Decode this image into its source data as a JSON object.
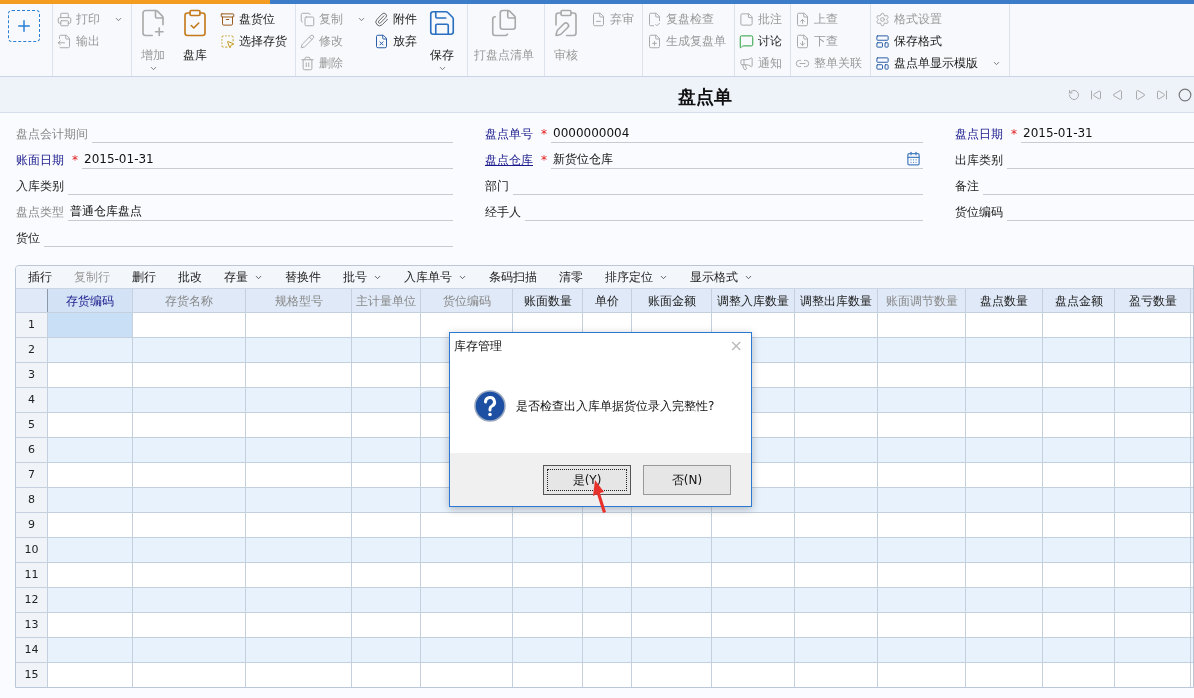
{
  "toolbar": [
    [
      {
        "kind": "new"
      }
    ],
    [
      {
        "kind": "stack",
        "items": [
          {
            "label": "打印",
            "disabled": true,
            "dropdown": true
          },
          {
            "label": "输出",
            "disabled": true,
            "dropdown": false
          }
        ]
      }
    ],
    [
      {
        "kind": "big",
        "label": "增加",
        "disabled": true,
        "dropdown": true
      },
      {
        "kind": "big",
        "label": "盘库",
        "disabled": false,
        "dropdown": false
      },
      {
        "kind": "stack",
        "items": [
          {
            "label": "盘货位",
            "disabled": false,
            "dropdown": false
          },
          {
            "label": "选择存货",
            "disabled": false,
            "dropdown": false
          }
        ]
      }
    ],
    [
      {
        "kind": "stack",
        "items": [
          {
            "label": "复制",
            "disabled": true,
            "dropdown": true
          },
          {
            "label": "修改",
            "disabled": true,
            "dropdown": false
          },
          {
            "label": "删除",
            "disabled": true,
            "dropdown": false
          }
        ]
      },
      {
        "kind": "stack",
        "items": [
          {
            "label": "附件",
            "disabled": false,
            "dropdown": false
          },
          {
            "label": "放弃",
            "disabled": false,
            "dropdown": false
          }
        ]
      },
      {
        "kind": "big",
        "label": "保存",
        "disabled": false,
        "dropdown": true
      }
    ],
    [
      {
        "kind": "big",
        "label": "打盘点清单",
        "disabled": true,
        "dropdown": false
      }
    ],
    [
      {
        "kind": "big",
        "label": "审核",
        "disabled": true,
        "dropdown": false
      },
      {
        "kind": "stack",
        "items": [
          {
            "label": "弃审",
            "disabled": true,
            "dropdown": false
          }
        ]
      }
    ],
    [
      {
        "kind": "stack",
        "items": [
          {
            "label": "复盘检查",
            "disabled": true,
            "dropdown": false
          },
          {
            "label": "生成复盘单",
            "disabled": true,
            "dropdown": false
          }
        ]
      }
    ],
    [
      {
        "kind": "stack",
        "items": [
          {
            "label": "批注",
            "disabled": true,
            "dropdown": false
          },
          {
            "label": "讨论",
            "disabled": false,
            "dropdown": false
          },
          {
            "label": "通知",
            "disabled": true,
            "dropdown": false
          }
        ]
      }
    ],
    [
      {
        "kind": "stack",
        "items": [
          {
            "label": "上查",
            "disabled": true,
            "dropdown": false
          },
          {
            "label": "下查",
            "disabled": true,
            "dropdown": false
          },
          {
            "label": "整单关联",
            "disabled": true,
            "dropdown": false
          }
        ]
      }
    ],
    [
      {
        "kind": "stack",
        "items": [
          {
            "label": "格式设置",
            "disabled": true,
            "dropdown": false
          },
          {
            "label": "保存格式",
            "disabled": false,
            "dropdown": false
          },
          {
            "label": "盘点单显示模版",
            "disabled": false,
            "dropdown": true
          }
        ]
      }
    ]
  ],
  "title": "盘点单",
  "form": [
    [
      {
        "label": "盘点会计期间",
        "disabled": true,
        "link": false,
        "picker": false
      },
      {
        "label": "账面日期",
        "required_mark": "*",
        "value": "2015-01-31",
        "disabled": false,
        "link": false,
        "picker": false
      },
      {
        "label": "入库类别",
        "disabled": false,
        "link": false,
        "picker": false
      },
      {
        "label": "盘点类型",
        "value": "普通仓库盘点",
        "disabled": true,
        "link": false,
        "picker": false
      },
      {
        "label": "货位",
        "disabled": false,
        "link": false,
        "picker": false
      }
    ],
    [
      {
        "label": "盘点单号",
        "required_mark": "*",
        "value": "0000000004",
        "disabled": false,
        "link": false,
        "picker": false
      },
      {
        "label": "盘点仓库",
        "required_mark": "*",
        "value": "新货位仓库",
        "disabled": false,
        "link": true,
        "picker": true
      },
      {
        "label": "部门",
        "disabled": false,
        "link": false,
        "picker": false
      },
      {
        "label": "经手人",
        "disabled": false,
        "link": false,
        "picker": false
      }
    ],
    [
      {
        "label": "盘点日期",
        "required_mark": "*",
        "value": "2015-01-31",
        "disabled": false,
        "link": false,
        "picker": false
      },
      {
        "label": "出库类别",
        "disabled": false,
        "link": false,
        "picker": false
      },
      {
        "label": "备注",
        "disabled": false,
        "link": false,
        "picker": false
      },
      {
        "label": "货位编码",
        "disabled": false,
        "link": false,
        "picker": false
      }
    ]
  ],
  "grid_toolbar": [
    {
      "label": "插行",
      "disabled": false,
      "dropdown": false
    },
    {
      "label": "复制行",
      "disabled": true,
      "dropdown": false
    },
    {
      "label": "删行",
      "disabled": false,
      "dropdown": false
    },
    {
      "label": "批改",
      "disabled": false,
      "dropdown": false
    },
    {
      "label": "存量",
      "disabled": false,
      "dropdown": true
    },
    {
      "label": "替换件",
      "disabled": false,
      "dropdown": false
    },
    {
      "label": "批号",
      "disabled": false,
      "dropdown": true
    },
    {
      "label": "入库单号",
      "disabled": false,
      "dropdown": true
    },
    {
      "label": "条码扫描",
      "disabled": false,
      "dropdown": false
    },
    {
      "label": "清零",
      "disabled": false,
      "dropdown": false
    },
    {
      "label": "排序定位",
      "disabled": false,
      "dropdown": true
    },
    {
      "label": "显示格式",
      "disabled": false,
      "dropdown": true
    }
  ],
  "table": {
    "columns": [
      {
        "label": "存货编码",
        "selected": true,
        "disabled": false
      },
      {
        "label": "存货名称",
        "selected": false,
        "disabled": true
      },
      {
        "label": "规格型号",
        "selected": false,
        "disabled": true
      },
      {
        "label": "主计量单位",
        "selected": false,
        "disabled": true
      },
      {
        "label": "货位编码",
        "selected": false,
        "disabled": true
      },
      {
        "label": "账面数量",
        "selected": false,
        "disabled": false
      },
      {
        "label": "单价",
        "selected": false,
        "disabled": false
      },
      {
        "label": "账面金额",
        "selected": false,
        "disabled": false
      },
      {
        "label": "调整入库数量",
        "selected": false,
        "disabled": false
      },
      {
        "label": "调整出库数量",
        "selected": false,
        "disabled": false
      },
      {
        "label": "账面调节数量",
        "selected": false,
        "disabled": true
      },
      {
        "label": "盘点数量",
        "selected": false,
        "disabled": false
      },
      {
        "label": "盘点金额",
        "selected": false,
        "disabled": false
      },
      {
        "label": "盈亏数量",
        "selected": false,
        "disabled": false
      }
    ],
    "rows": [
      {
        "number": "1",
        "selected": true
      },
      {
        "number": "2",
        "selected": false
      },
      {
        "number": "3",
        "selected": false
      },
      {
        "number": "4",
        "selected": false
      },
      {
        "number": "5",
        "selected": false
      },
      {
        "number": "6",
        "selected": false
      },
      {
        "number": "7",
        "selected": false
      },
      {
        "number": "8",
        "selected": false
      },
      {
        "number": "9",
        "selected": false
      },
      {
        "number": "10",
        "selected": false
      },
      {
        "number": "11",
        "selected": false
      },
      {
        "number": "12",
        "selected": false
      },
      {
        "number": "13",
        "selected": false
      },
      {
        "number": "14",
        "selected": false
      },
      {
        "number": "15",
        "selected": false
      }
    ]
  },
  "dialog": {
    "title": "库存管理",
    "close": "×",
    "message": "是否检查出入库单据货位录入完整性?",
    "buttons": [
      {
        "label": "是(Y)",
        "focused": true
      },
      {
        "label": "否(N)",
        "focused": false
      }
    ]
  }
}
